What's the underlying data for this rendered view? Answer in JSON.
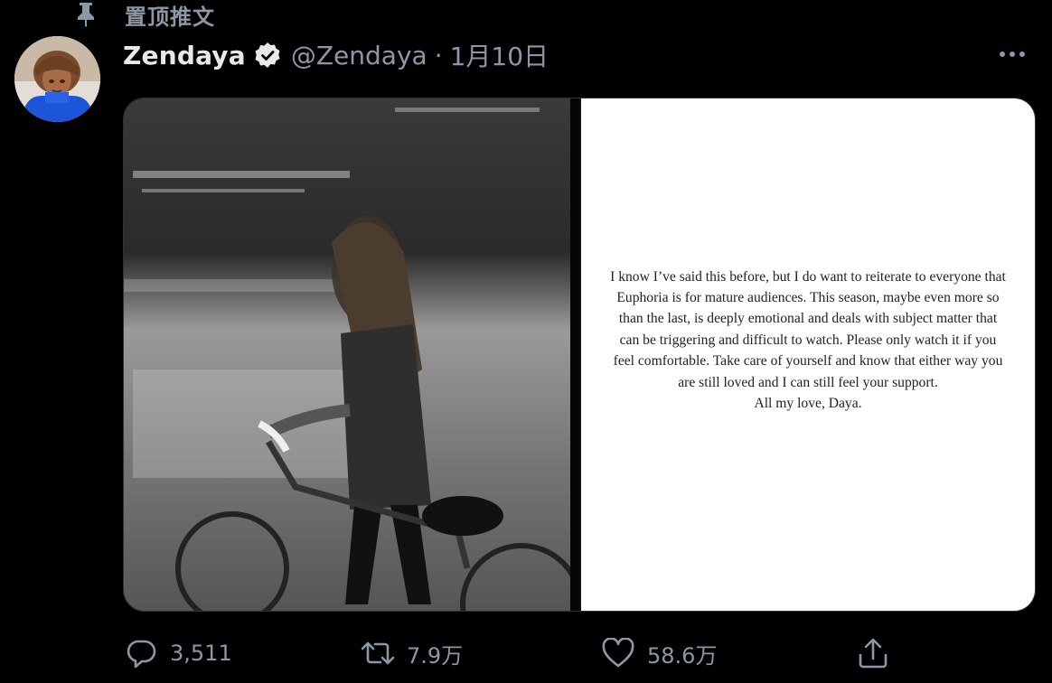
{
  "pinned": {
    "label": "置顶推文",
    "icon": "pin-icon"
  },
  "tweet": {
    "display_name": "Zendaya",
    "verified": true,
    "handle": "@Zendaya",
    "separator": "·",
    "date": "1月10日",
    "note": {
      "body": "I know I’ve said this before, but I do want to reiterate to everyone that Euphoria is for mature audiences. This season, maybe even more so than the last, is deeply emotional and deals with subject matter that can be triggering and difficult to watch. Please only watch it if you feel comfortable. Take care of yourself and know that either way you are still loved and I can still feel your support.",
      "signoff": "All my love, Daya."
    }
  },
  "actions": {
    "reply_count": "3,511",
    "retweet_count": "7.9万",
    "like_count": "58.6万"
  },
  "colors": {
    "background": "#000000",
    "text": "#e7e9ea",
    "muted": "#8b98a5",
    "card_border": "#2f3336"
  }
}
